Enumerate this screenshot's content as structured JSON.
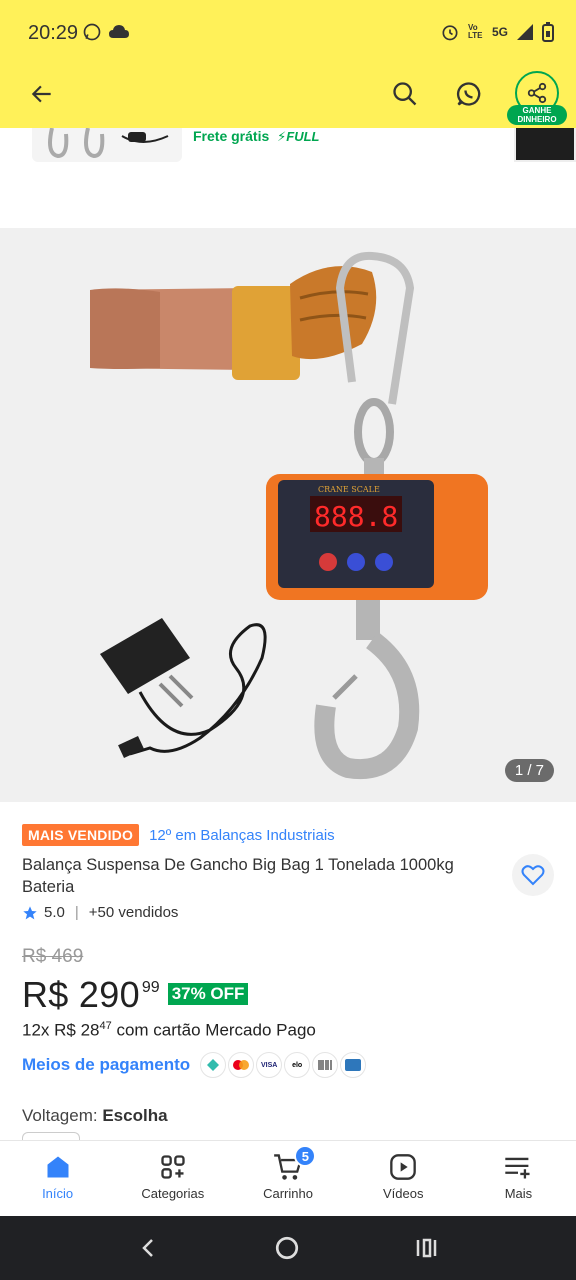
{
  "status_bar": {
    "time": "20:29",
    "network": "5G",
    "volte": "Vo LTE"
  },
  "header": {
    "share_badge": "GANHE DINHEIRO",
    "icons": [
      "back-arrow-icon",
      "search-icon",
      "whatsapp-icon",
      "share-icon"
    ]
  },
  "previous_item": {
    "shipping": "Frete grátis",
    "full": "FULL"
  },
  "gallery": {
    "counter": "1 / 7"
  },
  "product": {
    "badge": "MAIS VENDIDO",
    "rank": "12º em Balanças Industriais",
    "title": "Balança Suspensa De Gancho Big Bag 1 Tonelada 1000kg Bateria",
    "rating": "5.0",
    "sold": "+50 vendidos",
    "old_price": "R$ 469",
    "price": "R$ 290",
    "price_cents": "99",
    "discount": "37% OFF",
    "installments_prefix": "12x R$ 28",
    "installments_cents": "47",
    "installments_suffix": " com cartão Mercado Pago",
    "payment_link": "Meios de pagamento",
    "payment_methods": [
      "pix",
      "mastercard",
      "VISA",
      "elo",
      "boleto",
      "amex"
    ],
    "voltage_label": "Voltagem:",
    "voltage_value": "Escolha"
  },
  "nav": {
    "items": [
      {
        "label": "Início",
        "icon": "home-icon"
      },
      {
        "label": "Categorias",
        "icon": "categories-icon"
      },
      {
        "label": "Carrinho",
        "icon": "cart-icon"
      },
      {
        "label": "Vídeos",
        "icon": "video-icon"
      },
      {
        "label": "Mais",
        "icon": "menu-more-icon"
      }
    ],
    "cart_count": "5"
  },
  "colors": {
    "header_bg": "#FFF159",
    "accent_blue": "#3483fa",
    "green": "#00a650",
    "best_seller": "#ff7733"
  }
}
